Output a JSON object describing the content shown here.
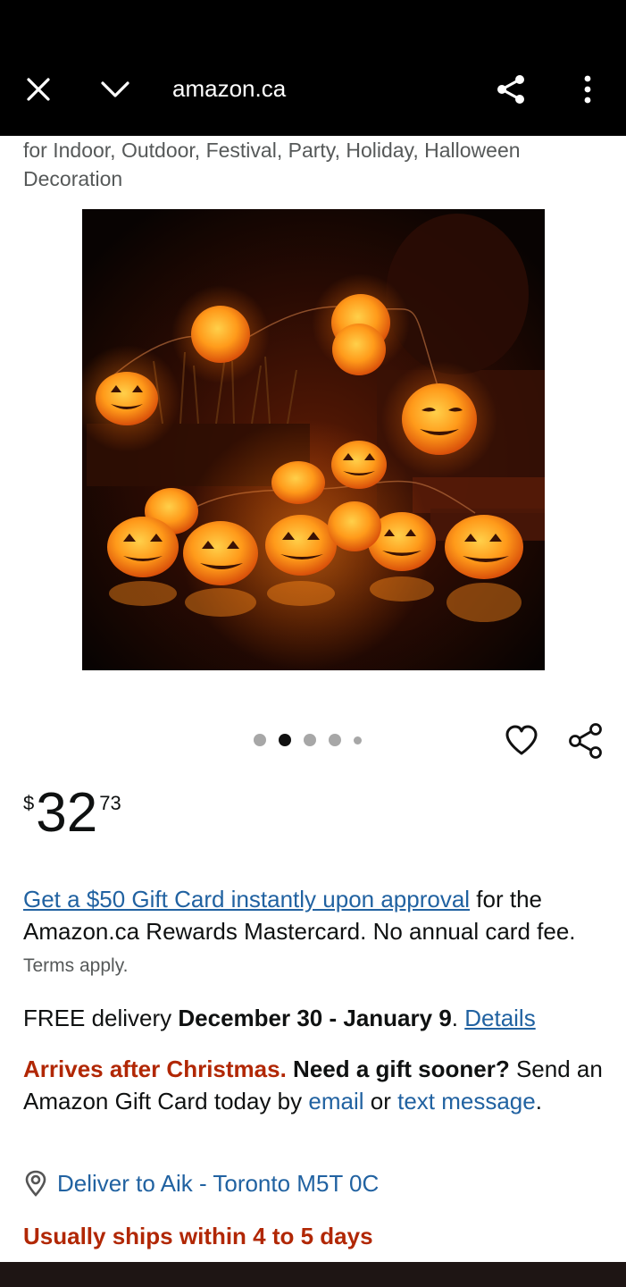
{
  "browser": {
    "url": "amazon.ca",
    "icons": {
      "close": "close-icon",
      "collapse": "chevron-down-icon",
      "share": "share-icon",
      "more": "more-vertical-icon"
    }
  },
  "product": {
    "title_tail": "for Indoor, Outdoor, Festival, Party, Holiday, Halloween Decoration",
    "gallery": {
      "total_images": 5,
      "active_index": 1
    }
  },
  "price": {
    "symbol": "$",
    "whole": "32",
    "fraction": "73"
  },
  "promo": {
    "link_text": "Get a $50 Gift Card instantly upon approval",
    "text": " for the Amazon.ca Rewards Mastercard. No annual card fee.",
    "terms": "Terms apply."
  },
  "delivery": {
    "prefix": "FREE delivery ",
    "dates": "December 30 - January 9",
    "sep": ". ",
    "details_link": "Details"
  },
  "gift": {
    "alert": "Arrives after Christmas.",
    "question": " Need a gift sooner?",
    "text1": " Send an Amazon Gift Card today by ",
    "email_link": "email",
    "text2": " or ",
    "text_link": "text message",
    "end": "."
  },
  "location": {
    "text": "Deliver to Aik - Toronto M5T 0C"
  },
  "shipping": {
    "text": "Usually ships within 4 to 5 days"
  },
  "colors": {
    "link": "#2162a1",
    "alert_red": "#b12704",
    "text": "#0f1111",
    "muted": "#565959"
  }
}
